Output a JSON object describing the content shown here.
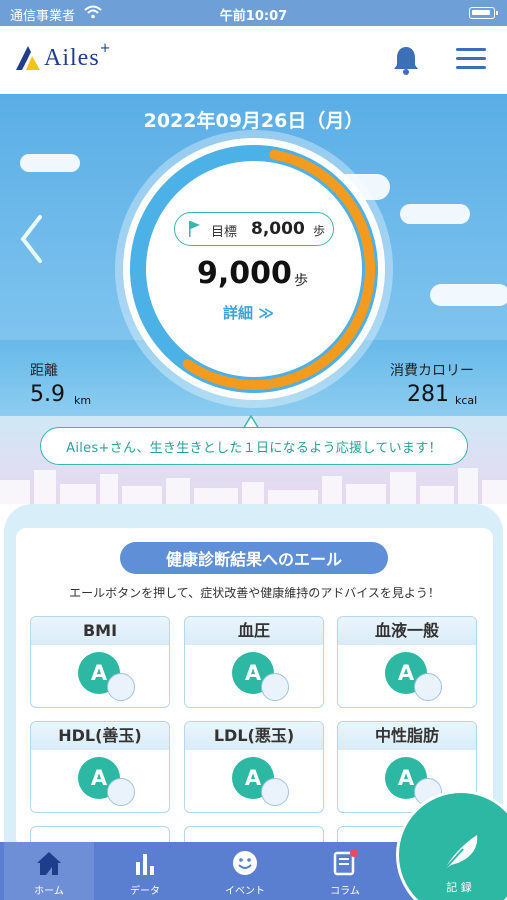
{
  "status_bar": {
    "carrier": "通信事業者",
    "time": "午前10:07"
  },
  "header": {
    "brand": "Ailes",
    "brand_sup": "+"
  },
  "hero": {
    "date": "2022年09月26日（月）",
    "goal_label": "目標",
    "goal_value": "8,000",
    "goal_unit": "歩",
    "steps_value": "9,000",
    "steps_unit": "歩",
    "detail_link": "詳細 ≫",
    "progress_fraction": 1.0,
    "distance": {
      "label": "距離",
      "value": "5.9",
      "unit": "km"
    },
    "calories": {
      "label": "消費カロリー",
      "value": "281",
      "unit": "kcal"
    },
    "cheer_message": "Ailes+さん、生き生きとした１日になるよう応援しています！"
  },
  "health": {
    "title": "健康診断結果へのエール",
    "subtitle": "エールボタンを押して、症状改善や健康維持のアドバイスを見よう！",
    "items": [
      {
        "name": "BMI",
        "grade": "A"
      },
      {
        "name": "血圧",
        "grade": "A"
      },
      {
        "name": "血液一般",
        "grade": "A"
      },
      {
        "name": "HDL(善玉)",
        "grade": "A"
      },
      {
        "name": "LDL(悪玉)",
        "grade": "A"
      },
      {
        "name": "中性脂肪",
        "grade": "A"
      }
    ]
  },
  "tabs": [
    {
      "label": "ホーム",
      "icon": "home-icon",
      "active": true
    },
    {
      "label": "データ",
      "icon": "chart-icon",
      "active": false
    },
    {
      "label": "イベント",
      "icon": "smile-icon",
      "active": false
    },
    {
      "label": "コラム",
      "icon": "column-icon",
      "active": false
    }
  ],
  "record_button": {
    "label": "記 録"
  },
  "colors": {
    "accent_teal": "#2cb8a3",
    "brand_blue": "#5b7fd0",
    "ring_orange": "#f29b1e",
    "ring_blue": "#4bb1e6"
  }
}
